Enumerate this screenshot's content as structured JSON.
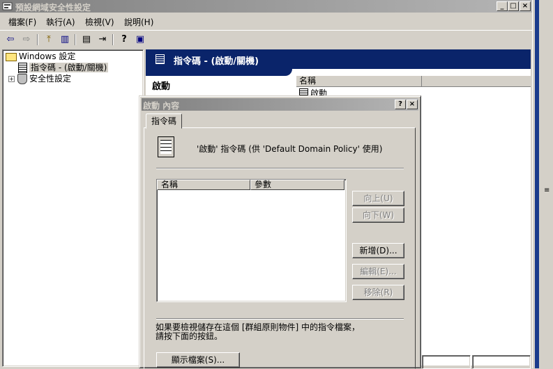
{
  "window": {
    "title": "預設網域安全性設定",
    "minimize": "_",
    "maximize": "□",
    "close": "×"
  },
  "menu": [
    {
      "label": "檔案(F)"
    },
    {
      "label": "執行(A)"
    },
    {
      "label": "檢視(V)"
    },
    {
      "label": "說明(H)"
    }
  ],
  "toolbar": {
    "back": "⇦",
    "forward": "⇨",
    "up": "⤒",
    "show_hide_tree": "▥",
    "properties": "▤",
    "export": "⇥",
    "help": "?",
    "console": "▣"
  },
  "tree": {
    "root": "Windows 設定",
    "scripts": "指令碼 - (啟動/關機)",
    "security": "安全性設定",
    "expander": "+"
  },
  "right_pane": {
    "header": "指令碼 - (啟動/關機)",
    "title": "啟動",
    "column_name": "名稱",
    "item": "啟動"
  },
  "dialog": {
    "title": "啟動 內容",
    "help_btn": "?",
    "close_btn": "×",
    "tab": "指令碼",
    "description": "'啟動' 指令碼 (供 'Default Domain Policy' 使用)",
    "col_name": "名稱",
    "col_params": "參數",
    "buttons": {
      "up": "向上(U)",
      "down": "向下(W)",
      "add": "新增(D)...",
      "edit": "編輯(E)...",
      "remove": "移除(R)"
    },
    "info": "如果要檢視儲存在這個 [群組原則物件] 中的指令檔案，\n請按下面的按鈕。",
    "show_files": "顯示檔案(S)..."
  },
  "right_strip": {
    "glyph": "≡"
  },
  "colors": {
    "face": "#d4d0c8",
    "header_blue": "#0a246a",
    "inactive_title_start": "#808080",
    "inactive_title_end": "#b5b5b5"
  }
}
